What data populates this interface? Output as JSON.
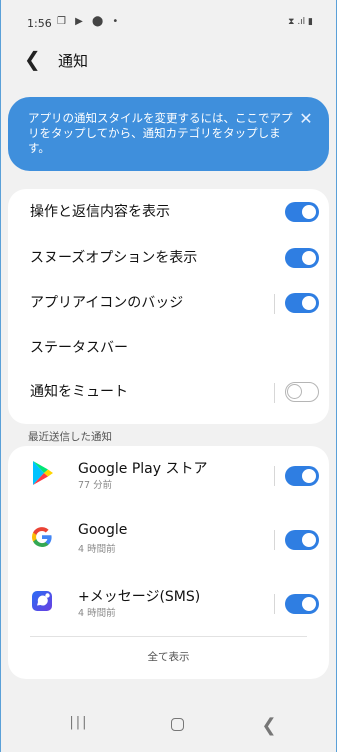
{
  "status_bar": {
    "time": "1:56",
    "icons": "❒ ▶ ⬤ •",
    "right": "⧗ .ıl ▮"
  },
  "header": {
    "back_glyph": "❮",
    "title": "通知"
  },
  "banner": {
    "text": "アプリの通知スタイルを変更するには、ここでアプリをタップしてから、通知カテゴリをタップします。",
    "close_glyph": "✕",
    "color": "#3f8fdc"
  },
  "settings": [
    {
      "label": "操作と返信内容を表示",
      "toggle": "on",
      "separator": false
    },
    {
      "label": "スヌーズオプションを表示",
      "toggle": "on",
      "separator": false
    },
    {
      "label": "アプリアイコンのバッジ",
      "toggle": "on",
      "separator": true
    },
    {
      "label": "ステータスバー",
      "toggle": null,
      "separator": false
    },
    {
      "label": "通知をミュート",
      "toggle": "off",
      "separator": true
    }
  ],
  "recent": {
    "header": "最近送信した通知",
    "apps": [
      {
        "name": "Google Play ストア",
        "time": "77 分前",
        "icon": "google-play-icon",
        "toggle": "on"
      },
      {
        "name": "Google",
        "time": "4 時間前",
        "icon": "google-icon",
        "toggle": "on"
      },
      {
        "name": "+メッセージ(SMS)",
        "time": "4 時間前",
        "icon": "messages-icon",
        "toggle": "on"
      }
    ],
    "show_all": "全て表示"
  },
  "nav": {
    "recent": "|||",
    "back": "❮"
  },
  "accent_color": "#2f7ee2"
}
